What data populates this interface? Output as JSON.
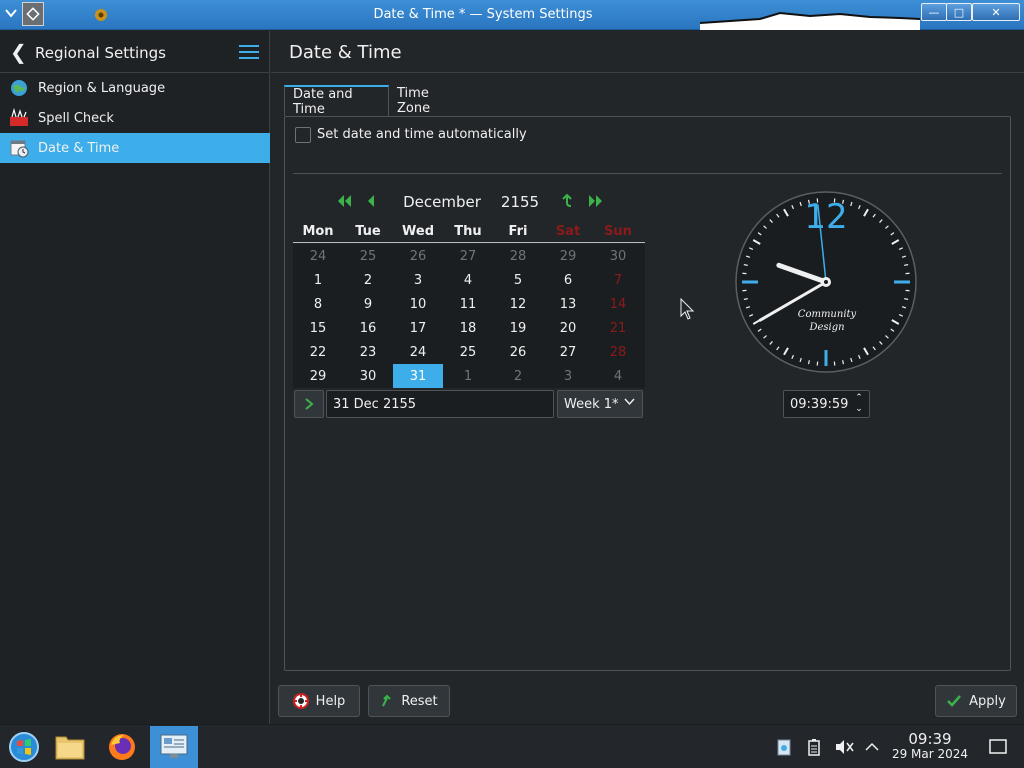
{
  "window": {
    "title": "Date & Time * — System Settings",
    "buttons": {
      "minimize": "—",
      "maximize": "□",
      "close": "✕"
    }
  },
  "sidebar": {
    "title": "Regional Settings",
    "items": [
      {
        "label": "Region & Language",
        "icon": "globe-icon"
      },
      {
        "label": "Spell Check",
        "icon": "spell-check-icon"
      },
      {
        "label": "Date & Time",
        "icon": "calendar-clock-icon",
        "active": true
      }
    ]
  },
  "main": {
    "title": "Date & Time",
    "tabs": [
      {
        "label": "Date and Time",
        "active": true
      },
      {
        "label": "Time Zone",
        "active": false
      }
    ],
    "auto_checkbox": {
      "label": "Set date and time automatically",
      "checked": false
    }
  },
  "calendar": {
    "month": "December",
    "year": "2155",
    "weekdays": [
      "Mon",
      "Tue",
      "Wed",
      "Thu",
      "Fri",
      "Sat",
      "Sun"
    ],
    "weeks": [
      [
        "24",
        "25",
        "26",
        "27",
        "28",
        "29",
        "30"
      ],
      [
        "1",
        "2",
        "3",
        "4",
        "5",
        "6",
        "7"
      ],
      [
        "8",
        "9",
        "10",
        "11",
        "12",
        "13",
        "14"
      ],
      [
        "15",
        "16",
        "17",
        "18",
        "19",
        "20",
        "21"
      ],
      [
        "22",
        "23",
        "24",
        "25",
        "26",
        "27",
        "28"
      ],
      [
        "29",
        "30",
        "31",
        "1",
        "2",
        "3",
        "4"
      ]
    ],
    "selected": "31",
    "date_value": "31 Dec 2155",
    "week_value": "Week 1*",
    "weekend_color": "#8b1a1a",
    "selection_color": "#3daee9"
  },
  "clock": {
    "label_top": "12",
    "brand_line1": "Community",
    "brand_line2": "Design",
    "time_value": "09:39:59",
    "hours": 9,
    "minutes": 39,
    "seconds": 59
  },
  "buttons": {
    "help": "Help",
    "reset": "Reset",
    "apply": "Apply"
  },
  "taskbar": {
    "apps": [
      "start-menu-icon",
      "file-manager-icon",
      "firefox-icon",
      "system-settings-icon"
    ],
    "time": "09:39",
    "date": "29 Mar 2024"
  },
  "colors": {
    "accent": "#3daee9",
    "background": "#232629",
    "titlebar": "#2a76c0",
    "nav_green": "#3bb34a"
  }
}
